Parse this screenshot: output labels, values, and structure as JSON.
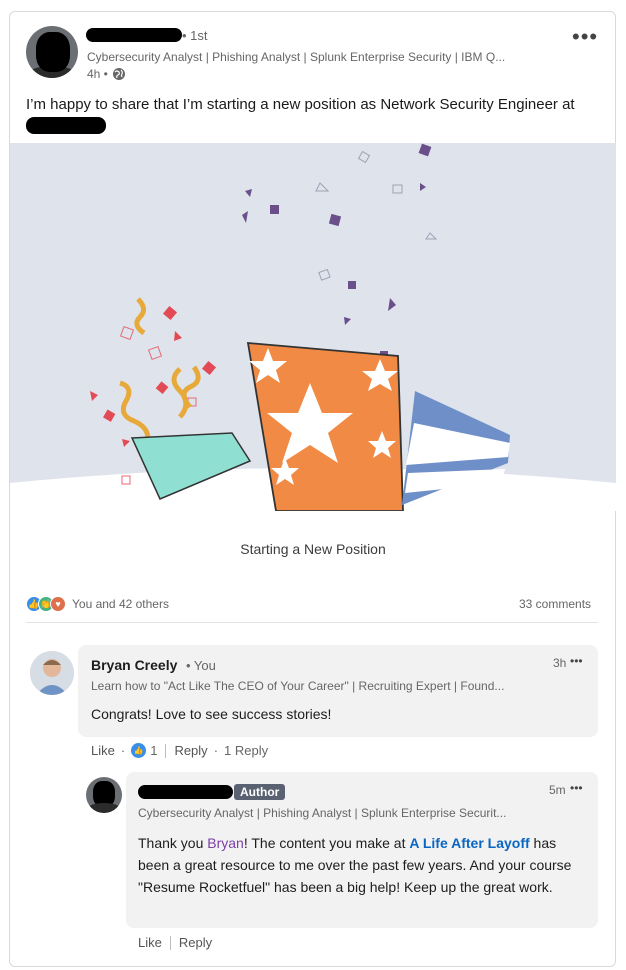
{
  "post": {
    "degree": "• 1st",
    "headline": "Cybersecurity Analyst | Phishing Analyst | Splunk Enterprise Security | IBM Q...",
    "time": "4h •",
    "text": "I’m happy to share that I’m starting a new position as Network Security Engineer at",
    "more_icon": "more-horizontal-icon",
    "visibility_icon": "globe-icon",
    "card_title": "Starting a New Position",
    "reactions_text": "You and 42 others",
    "comments_count": "33 comments"
  },
  "comments": [
    {
      "name": "Bryan Creely",
      "tag": "• You",
      "headline": "Learn how to \"Act Like The CEO of Your Career\" | Recruiting Expert | Found...",
      "time": "3h",
      "text": "Congrats! Love to see success stories!",
      "like_label": "Like",
      "like_count": "1",
      "reply_label": "Reply",
      "replies_label": "1 Reply"
    }
  ],
  "reply": {
    "badge": "Author",
    "headline": "Cybersecurity Analyst | Phishing Analyst | Splunk Enterprise Securit...",
    "time": "5m",
    "text_1": "Thank you ",
    "mention": "Bryan",
    "text_2": "! The content you make at ",
    "company": "A Life After Layoff",
    "text_3": " has been a great resource to me over the past few years. And your course \"Resume Rocketfuel\" has been a big help! Keep up the great work.",
    "like_label": "Like",
    "reply_label": "Reply"
  },
  "dots_label": "•••",
  "colors": {
    "accent_blue": "#0a66c2",
    "mention_purple": "#7b3fa6",
    "banner_bg": "#dfe4ec",
    "gift_orange": "#f08a45",
    "gift_mint": "#8fe0d3",
    "gift_blue": "#6f8fc9"
  }
}
